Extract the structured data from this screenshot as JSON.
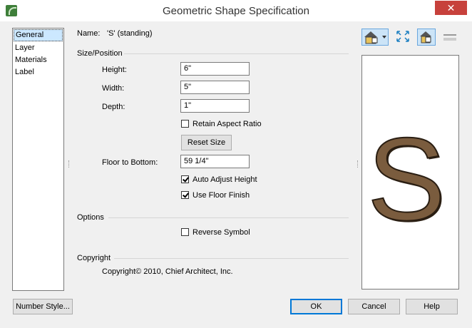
{
  "window": {
    "title": "Geometric Shape Specification",
    "close_glyph": "✕"
  },
  "sidebar": {
    "items": [
      {
        "label": "General",
        "selected": true
      },
      {
        "label": "Layer"
      },
      {
        "label": "Materials"
      },
      {
        "label": "Label"
      }
    ]
  },
  "name": {
    "label": "Name:",
    "value": "'S' (standing)"
  },
  "size_position": {
    "title": "Size/Position",
    "height_label": "Height:",
    "height_value": "6\"",
    "width_label": "Width:",
    "width_value": "5\"",
    "depth_label": "Depth:",
    "depth_value": "1\"",
    "retain_aspect_label": "Retain Aspect Ratio",
    "retain_aspect_checked": false,
    "reset_size_label": "Reset Size",
    "floor_to_bottom_label": "Floor to Bottom:",
    "floor_to_bottom_value": "59 1/4\"",
    "auto_adjust_label": "Auto Adjust Height",
    "auto_adjust_checked": true,
    "use_floor_finish_label": "Use Floor Finish",
    "use_floor_finish_checked": true
  },
  "options": {
    "title": "Options",
    "reverse_symbol_label": "Reverse Symbol",
    "reverse_symbol_checked": false
  },
  "copyright": {
    "title": "Copyright",
    "text": "Copyright© 2010, Chief Architect, Inc."
  },
  "preview": {
    "glyph": "S",
    "fill_color": "#7a5c3e",
    "outline_color": "#2a1e12"
  },
  "toolbar": {
    "icons": [
      "view-camera-icon",
      "dropdown-arrow-icon",
      "fill-window-icon",
      "plan-view-icon",
      "elevation-view-icon"
    ]
  },
  "buttons": {
    "number_style": "Number Style...",
    "ok": "OK",
    "cancel": "Cancel",
    "help": "Help"
  },
  "colors": {
    "close_button": "#c7413c",
    "selection": "#cce8ff",
    "default_button_border": "#0078d7"
  }
}
